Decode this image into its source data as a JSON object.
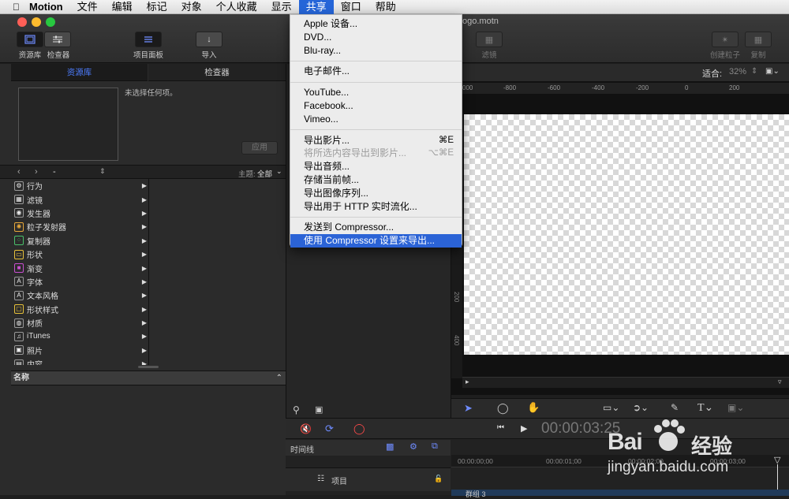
{
  "menubar": {
    "apple": "",
    "app": "Motion",
    "items": [
      "文件",
      "编辑",
      "标记",
      "对象",
      "个人收藏",
      "显示",
      "共享",
      "窗口",
      "帮助"
    ]
  },
  "toolbar": {
    "library_label": "资源库",
    "inspector_label": "检查器",
    "projectpanel_label": "项目面板",
    "import_label": "导入",
    "filters_label": "滤镜",
    "create_particles_label": "创建粒子",
    "replicate_label": "复制",
    "doc_title": "ogo.motn"
  },
  "left": {
    "tab_library": "资源库",
    "tab_inspector": "检查器",
    "no_selection": "未选择任何项。",
    "apply": "应用",
    "nav_dash": "-",
    "theme_label": "主题:",
    "theme_value": "全部",
    "library_items": [
      {
        "label": "行为",
        "icon": "gear-icon"
      },
      {
        "label": "滤镜",
        "icon": "filter-icon"
      },
      {
        "label": "发生器",
        "icon": "generator-icon"
      },
      {
        "label": "粒子发射器",
        "icon": "particle-icon"
      },
      {
        "label": "复制器",
        "icon": "replicator-icon"
      },
      {
        "label": "形状",
        "icon": "shape-icon"
      },
      {
        "label": "渐变",
        "icon": "gradient-icon"
      },
      {
        "label": "字体",
        "icon": "font-icon"
      },
      {
        "label": "文本风格",
        "icon": "text-style-icon"
      },
      {
        "label": "形状样式",
        "icon": "shape-style-icon"
      },
      {
        "label": "材质",
        "icon": "material-icon"
      },
      {
        "label": "iTunes",
        "icon": "music-icon"
      },
      {
        "label": "照片",
        "icon": "photo-icon"
      },
      {
        "label": "内容",
        "icon": "content-icon"
      }
    ],
    "name_header": "名称"
  },
  "share_menu": {
    "items": [
      {
        "label": "Apple 设备...",
        "shortcut": "",
        "disabled": false
      },
      {
        "label": "DVD...",
        "shortcut": "",
        "disabled": false
      },
      {
        "label": "Blu-ray...",
        "shortcut": "",
        "disabled": false
      },
      {
        "sep": true
      },
      {
        "label": "电子邮件...",
        "shortcut": "",
        "disabled": false
      },
      {
        "sep": true
      },
      {
        "label": "YouTube...",
        "shortcut": "",
        "disabled": false
      },
      {
        "label": "Facebook...",
        "shortcut": "",
        "disabled": false
      },
      {
        "label": "Vimeo...",
        "shortcut": "",
        "disabled": false
      },
      {
        "sep": true
      },
      {
        "label": "导出影片...",
        "shortcut": "⌘E",
        "disabled": false
      },
      {
        "label": "将所选内容导出到影片...",
        "shortcut": "⌥⌘E",
        "disabled": true
      },
      {
        "label": "导出音频...",
        "shortcut": "",
        "disabled": false
      },
      {
        "label": "存储当前帧...",
        "shortcut": "",
        "disabled": false
      },
      {
        "label": "导出图像序列...",
        "shortcut": "",
        "disabled": false
      },
      {
        "label": "导出用于 HTTP 实时流化...",
        "shortcut": "",
        "disabled": false
      },
      {
        "sep": true
      },
      {
        "label": "发送到 Compressor...",
        "shortcut": "",
        "disabled": false
      },
      {
        "label": "使用 Compressor 设置来导出...",
        "shortcut": "",
        "disabled": false,
        "highlight": true
      }
    ]
  },
  "canvas": {
    "fit_label": "适合:",
    "zoom": "32%",
    "ruler_ticks": [
      "000",
      "-800",
      "-600",
      "-400",
      "-200",
      "0",
      "200"
    ],
    "vruler_ticks": [
      "200",
      "400"
    ]
  },
  "timeline": {
    "label": "时间线",
    "timecode": "00:00:03:25",
    "project_label": "项目",
    "group_label": "群组 3",
    "ticks": [
      "00:00:00;00",
      "00:00:01;00",
      "00:00:02;00",
      "00:00:03;00"
    ]
  },
  "watermark": {
    "brand_left": "Bai",
    "brand_right": "经验",
    "url": "jingyan.baidu.com"
  },
  "colors": {
    "menu_highlight": "#2b63d6",
    "accent_blue": "#4d7dff",
    "close": "#ff5f57",
    "minimize": "#febc2e",
    "zoom": "#28c840"
  }
}
